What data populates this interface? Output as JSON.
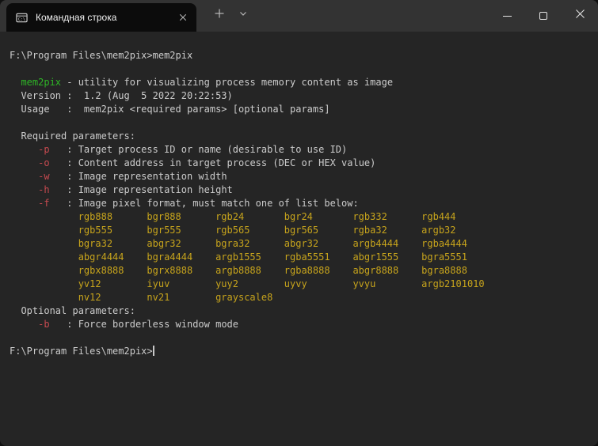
{
  "window": {
    "tab": {
      "title": "Командная строка"
    },
    "icons": {
      "tab_icon": "cmd-window-icon",
      "tab_close": "close-icon",
      "new_tab": "plus-icon",
      "tab_dropdown": "chevron-down-icon",
      "minimize": "minimize-icon",
      "maximize": "maximize-icon",
      "close": "close-icon"
    }
  },
  "colors": {
    "titlebar_bg": "#333333",
    "tab_bg": "#0c0c0c",
    "terminal_bg": "#252525",
    "foreground": "#cccccc",
    "accent_green": "#2eb626",
    "accent_red": "#c74a50",
    "accent_yellow": "#c7a41c"
  },
  "terminal": {
    "prompt": "F:\\Program Files\\mem2pix>",
    "lines": [
      {
        "segments": [
          {
            "t": "F:\\Program Files\\mem2pix>mem2pix"
          }
        ]
      },
      {
        "segments": []
      },
      {
        "segments": [
          {
            "t": "  "
          },
          {
            "t": "mem2pix",
            "c": "green"
          },
          {
            "t": " - utility for visualizing process memory content as image"
          }
        ]
      },
      {
        "segments": [
          {
            "t": "  Version :  1.2 (Aug  5 2022 20:22:53)"
          }
        ]
      },
      {
        "segments": [
          {
            "t": "  Usage   :  mem2pix <required params> [optional params]"
          }
        ]
      },
      {
        "segments": []
      },
      {
        "segments": [
          {
            "t": "  Required parameters:"
          }
        ]
      },
      {
        "segments": [
          {
            "t": "     "
          },
          {
            "t": "-p",
            "c": "red"
          },
          {
            "t": "   : Target process ID or name (desirable to use ID)"
          }
        ]
      },
      {
        "segments": [
          {
            "t": "     "
          },
          {
            "t": "-o",
            "c": "red"
          },
          {
            "t": "   : Content address in target process (DEC or HEX value)"
          }
        ]
      },
      {
        "segments": [
          {
            "t": "     "
          },
          {
            "t": "-w",
            "c": "red"
          },
          {
            "t": "   : Image representation width"
          }
        ]
      },
      {
        "segments": [
          {
            "t": "     "
          },
          {
            "t": "-h",
            "c": "red"
          },
          {
            "t": "   : Image representation height"
          }
        ]
      },
      {
        "segments": [
          {
            "t": "     "
          },
          {
            "t": "-f",
            "c": "red"
          },
          {
            "t": "   : Image pixel format, must match one of list below:"
          }
        ]
      },
      {
        "segments": [
          {
            "t": "            "
          },
          {
            "t": "rgb888",
            "c": "yellow",
            "cell": true
          },
          {
            "t": "bgr888",
            "c": "yellow",
            "cell": true
          },
          {
            "t": "rgb24",
            "c": "yellow",
            "cell": true
          },
          {
            "t": "bgr24",
            "c": "yellow",
            "cell": true
          },
          {
            "t": "rgb332",
            "c": "yellow",
            "cell": true
          },
          {
            "t": "rgb444",
            "c": "yellow"
          }
        ]
      },
      {
        "segments": [
          {
            "t": "            "
          },
          {
            "t": "rgb555",
            "c": "yellow",
            "cell": true
          },
          {
            "t": "bgr555",
            "c": "yellow",
            "cell": true
          },
          {
            "t": "rgb565",
            "c": "yellow",
            "cell": true
          },
          {
            "t": "bgr565",
            "c": "yellow",
            "cell": true
          },
          {
            "t": "rgba32",
            "c": "yellow",
            "cell": true
          },
          {
            "t": "argb32",
            "c": "yellow"
          }
        ]
      },
      {
        "segments": [
          {
            "t": "            "
          },
          {
            "t": "bgra32",
            "c": "yellow",
            "cell": true
          },
          {
            "t": "abgr32",
            "c": "yellow",
            "cell": true
          },
          {
            "t": "bgra32",
            "c": "yellow",
            "cell": true
          },
          {
            "t": "abgr32",
            "c": "yellow",
            "cell": true
          },
          {
            "t": "argb4444",
            "c": "yellow",
            "cell": true
          },
          {
            "t": "rgba4444",
            "c": "yellow"
          }
        ]
      },
      {
        "segments": [
          {
            "t": "            "
          },
          {
            "t": "abgr4444",
            "c": "yellow",
            "cell": true
          },
          {
            "t": "bgra4444",
            "c": "yellow",
            "cell": true
          },
          {
            "t": "argb1555",
            "c": "yellow",
            "cell": true
          },
          {
            "t": "rgba5551",
            "c": "yellow",
            "cell": true
          },
          {
            "t": "abgr1555",
            "c": "yellow",
            "cell": true
          },
          {
            "t": "bgra5551",
            "c": "yellow"
          }
        ]
      },
      {
        "segments": [
          {
            "t": "            "
          },
          {
            "t": "rgbx8888",
            "c": "yellow",
            "cell": true
          },
          {
            "t": "bgrx8888",
            "c": "yellow",
            "cell": true
          },
          {
            "t": "argb8888",
            "c": "yellow",
            "cell": true
          },
          {
            "t": "rgba8888",
            "c": "yellow",
            "cell": true
          },
          {
            "t": "abgr8888",
            "c": "yellow",
            "cell": true
          },
          {
            "t": "bgra8888",
            "c": "yellow"
          }
        ]
      },
      {
        "segments": [
          {
            "t": "            "
          },
          {
            "t": "yv12",
            "c": "yellow",
            "cell": true
          },
          {
            "t": "iyuv",
            "c": "yellow",
            "cell": true
          },
          {
            "t": "yuy2",
            "c": "yellow",
            "cell": true
          },
          {
            "t": "uyvy",
            "c": "yellow",
            "cell": true
          },
          {
            "t": "yvyu",
            "c": "yellow",
            "cell": true
          },
          {
            "t": "argb2101010",
            "c": "yellow"
          }
        ]
      },
      {
        "segments": [
          {
            "t": "            "
          },
          {
            "t": "nv12",
            "c": "yellow",
            "cell": true
          },
          {
            "t": "nv21",
            "c": "yellow",
            "cell": true
          },
          {
            "t": "grayscale8",
            "c": "yellow"
          }
        ]
      },
      {
        "segments": [
          {
            "t": "  Optional parameters:"
          }
        ]
      },
      {
        "segments": [
          {
            "t": "     "
          },
          {
            "t": "-b",
            "c": "red"
          },
          {
            "t": "   : Force borderless window mode"
          }
        ]
      },
      {
        "segments": []
      },
      {
        "segments": [
          {
            "t": "F:\\Program Files\\mem2pix>"
          },
          {
            "cursor": true
          }
        ]
      }
    ]
  }
}
